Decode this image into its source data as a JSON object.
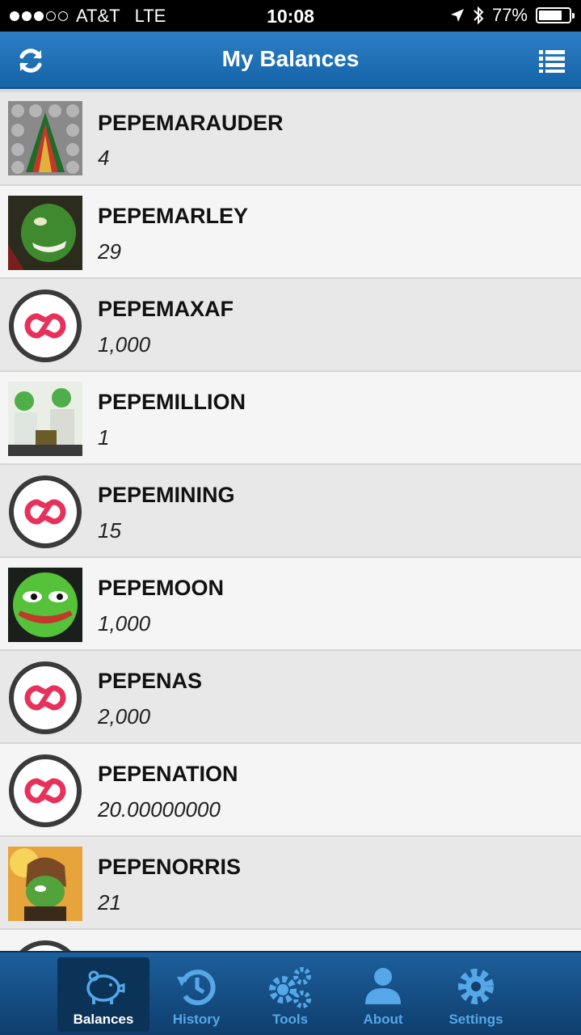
{
  "status_bar": {
    "carrier": "AT&T",
    "network": "LTE",
    "time": "10:08",
    "battery": "77%",
    "battery_level": 0.77
  },
  "header": {
    "title": "My Balances",
    "refresh_icon": "refresh-icon",
    "menu_icon": "list-icon"
  },
  "balances": [
    {
      "name": "PEPEMARAUDER",
      "qty": "4",
      "thumb": "image"
    },
    {
      "name": "PEPEMARLEY",
      "qty": "29",
      "thumb": "image"
    },
    {
      "name": "PEPEMAXAF",
      "qty": "1,000",
      "thumb": "counterparty-logo"
    },
    {
      "name": "PEPEMILLION",
      "qty": "1",
      "thumb": "image"
    },
    {
      "name": "PEPEMINING",
      "qty": "15",
      "thumb": "counterparty-logo"
    },
    {
      "name": "PEPEMOON",
      "qty": "1,000",
      "thumb": "image"
    },
    {
      "name": "PEPENAS",
      "qty": "2,000",
      "thumb": "counterparty-logo"
    },
    {
      "name": "PEPENATION",
      "qty": "20.00000000",
      "thumb": "counterparty-logo"
    },
    {
      "name": "PEPENORRIS",
      "qty": "21",
      "thumb": "image"
    }
  ],
  "tabs": [
    {
      "label": "Balances",
      "icon": "piggy-bank-icon",
      "active": true
    },
    {
      "label": "History",
      "icon": "history-icon",
      "active": false
    },
    {
      "label": "Tools",
      "icon": "gears-icon",
      "active": false
    },
    {
      "label": "About",
      "icon": "user-icon",
      "active": false
    },
    {
      "label": "Settings",
      "icon": "gear-icon",
      "active": false
    }
  ],
  "colors": {
    "header_blue": "#1d6fb5",
    "tab_active_label": "#ffffff",
    "tab_label": "#56a7e8",
    "logo_red": "#e8315a"
  }
}
